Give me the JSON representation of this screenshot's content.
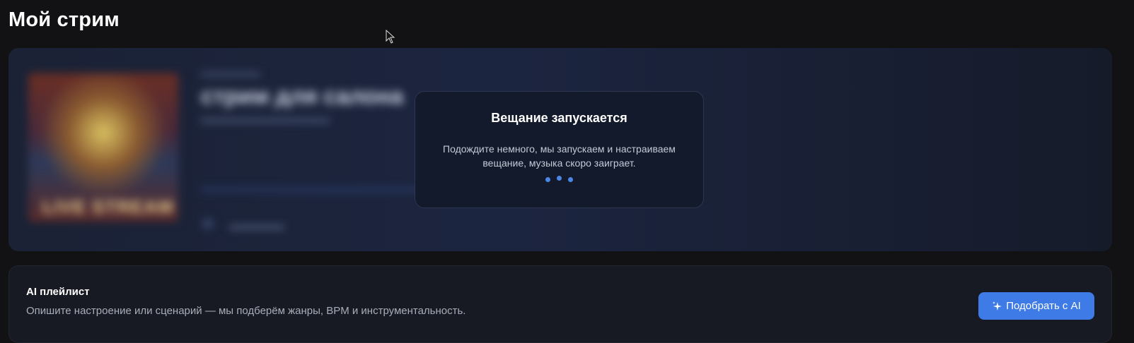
{
  "page": {
    "title": "Мой стрим"
  },
  "stream_card": {
    "cover_text": "LIVE STREAM",
    "title": "стрим для салона"
  },
  "modal": {
    "title": "Вещание запускается",
    "text_line1": "Подождите немного, мы запускаем и настраиваем",
    "text_line2": "вещание, музыка скоро заиграет."
  },
  "ai_playlist": {
    "title": "AI плейлист",
    "description": "Опишите настроение или сценарий — мы подберём жанры, BPM и инструментальность.",
    "button_label": "Подобрать с AI",
    "button_icon": "sparkle-icon"
  },
  "colors": {
    "accent": "#3e7be6",
    "dots": "#4d86e8",
    "background": "#121214"
  }
}
